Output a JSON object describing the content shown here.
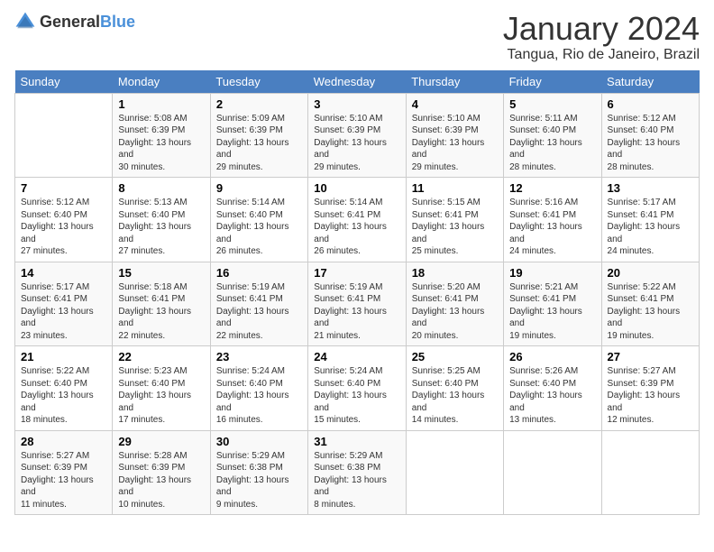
{
  "header": {
    "logo_general": "General",
    "logo_blue": "Blue",
    "month": "January 2024",
    "location": "Tangua, Rio de Janeiro, Brazil"
  },
  "calendar": {
    "days_of_week": [
      "Sunday",
      "Monday",
      "Tuesday",
      "Wednesday",
      "Thursday",
      "Friday",
      "Saturday"
    ],
    "weeks": [
      [
        {
          "day": "",
          "sunrise": "",
          "sunset": "",
          "daylight": ""
        },
        {
          "day": "1",
          "sunrise": "5:08 AM",
          "sunset": "6:39 PM",
          "daylight": "13 hours and 30 minutes."
        },
        {
          "day": "2",
          "sunrise": "5:09 AM",
          "sunset": "6:39 PM",
          "daylight": "13 hours and 29 minutes."
        },
        {
          "day": "3",
          "sunrise": "5:10 AM",
          "sunset": "6:39 PM",
          "daylight": "13 hours and 29 minutes."
        },
        {
          "day": "4",
          "sunrise": "5:10 AM",
          "sunset": "6:39 PM",
          "daylight": "13 hours and 29 minutes."
        },
        {
          "day": "5",
          "sunrise": "5:11 AM",
          "sunset": "6:40 PM",
          "daylight": "13 hours and 28 minutes."
        },
        {
          "day": "6",
          "sunrise": "5:12 AM",
          "sunset": "6:40 PM",
          "daylight": "13 hours and 28 minutes."
        }
      ],
      [
        {
          "day": "7",
          "sunrise": "5:12 AM",
          "sunset": "6:40 PM",
          "daylight": "13 hours and 27 minutes."
        },
        {
          "day": "8",
          "sunrise": "5:13 AM",
          "sunset": "6:40 PM",
          "daylight": "13 hours and 27 minutes."
        },
        {
          "day": "9",
          "sunrise": "5:14 AM",
          "sunset": "6:40 PM",
          "daylight": "13 hours and 26 minutes."
        },
        {
          "day": "10",
          "sunrise": "5:14 AM",
          "sunset": "6:41 PM",
          "daylight": "13 hours and 26 minutes."
        },
        {
          "day": "11",
          "sunrise": "5:15 AM",
          "sunset": "6:41 PM",
          "daylight": "13 hours and 25 minutes."
        },
        {
          "day": "12",
          "sunrise": "5:16 AM",
          "sunset": "6:41 PM",
          "daylight": "13 hours and 24 minutes."
        },
        {
          "day": "13",
          "sunrise": "5:17 AM",
          "sunset": "6:41 PM",
          "daylight": "13 hours and 24 minutes."
        }
      ],
      [
        {
          "day": "14",
          "sunrise": "5:17 AM",
          "sunset": "6:41 PM",
          "daylight": "13 hours and 23 minutes."
        },
        {
          "day": "15",
          "sunrise": "5:18 AM",
          "sunset": "6:41 PM",
          "daylight": "13 hours and 22 minutes."
        },
        {
          "day": "16",
          "sunrise": "5:19 AM",
          "sunset": "6:41 PM",
          "daylight": "13 hours and 22 minutes."
        },
        {
          "day": "17",
          "sunrise": "5:19 AM",
          "sunset": "6:41 PM",
          "daylight": "13 hours and 21 minutes."
        },
        {
          "day": "18",
          "sunrise": "5:20 AM",
          "sunset": "6:41 PM",
          "daylight": "13 hours and 20 minutes."
        },
        {
          "day": "19",
          "sunrise": "5:21 AM",
          "sunset": "6:41 PM",
          "daylight": "13 hours and 19 minutes."
        },
        {
          "day": "20",
          "sunrise": "5:22 AM",
          "sunset": "6:41 PM",
          "daylight": "13 hours and 19 minutes."
        }
      ],
      [
        {
          "day": "21",
          "sunrise": "5:22 AM",
          "sunset": "6:40 PM",
          "daylight": "13 hours and 18 minutes."
        },
        {
          "day": "22",
          "sunrise": "5:23 AM",
          "sunset": "6:40 PM",
          "daylight": "13 hours and 17 minutes."
        },
        {
          "day": "23",
          "sunrise": "5:24 AM",
          "sunset": "6:40 PM",
          "daylight": "13 hours and 16 minutes."
        },
        {
          "day": "24",
          "sunrise": "5:24 AM",
          "sunset": "6:40 PM",
          "daylight": "13 hours and 15 minutes."
        },
        {
          "day": "25",
          "sunrise": "5:25 AM",
          "sunset": "6:40 PM",
          "daylight": "13 hours and 14 minutes."
        },
        {
          "day": "26",
          "sunrise": "5:26 AM",
          "sunset": "6:40 PM",
          "daylight": "13 hours and 13 minutes."
        },
        {
          "day": "27",
          "sunrise": "5:27 AM",
          "sunset": "6:39 PM",
          "daylight": "13 hours and 12 minutes."
        }
      ],
      [
        {
          "day": "28",
          "sunrise": "5:27 AM",
          "sunset": "6:39 PM",
          "daylight": "13 hours and 11 minutes."
        },
        {
          "day": "29",
          "sunrise": "5:28 AM",
          "sunset": "6:39 PM",
          "daylight": "13 hours and 10 minutes."
        },
        {
          "day": "30",
          "sunrise": "5:29 AM",
          "sunset": "6:38 PM",
          "daylight": "13 hours and 9 minutes."
        },
        {
          "day": "31",
          "sunrise": "5:29 AM",
          "sunset": "6:38 PM",
          "daylight": "13 hours and 8 minutes."
        },
        {
          "day": "",
          "sunrise": "",
          "sunset": "",
          "daylight": ""
        },
        {
          "day": "",
          "sunrise": "",
          "sunset": "",
          "daylight": ""
        },
        {
          "day": "",
          "sunrise": "",
          "sunset": "",
          "daylight": ""
        }
      ]
    ]
  }
}
